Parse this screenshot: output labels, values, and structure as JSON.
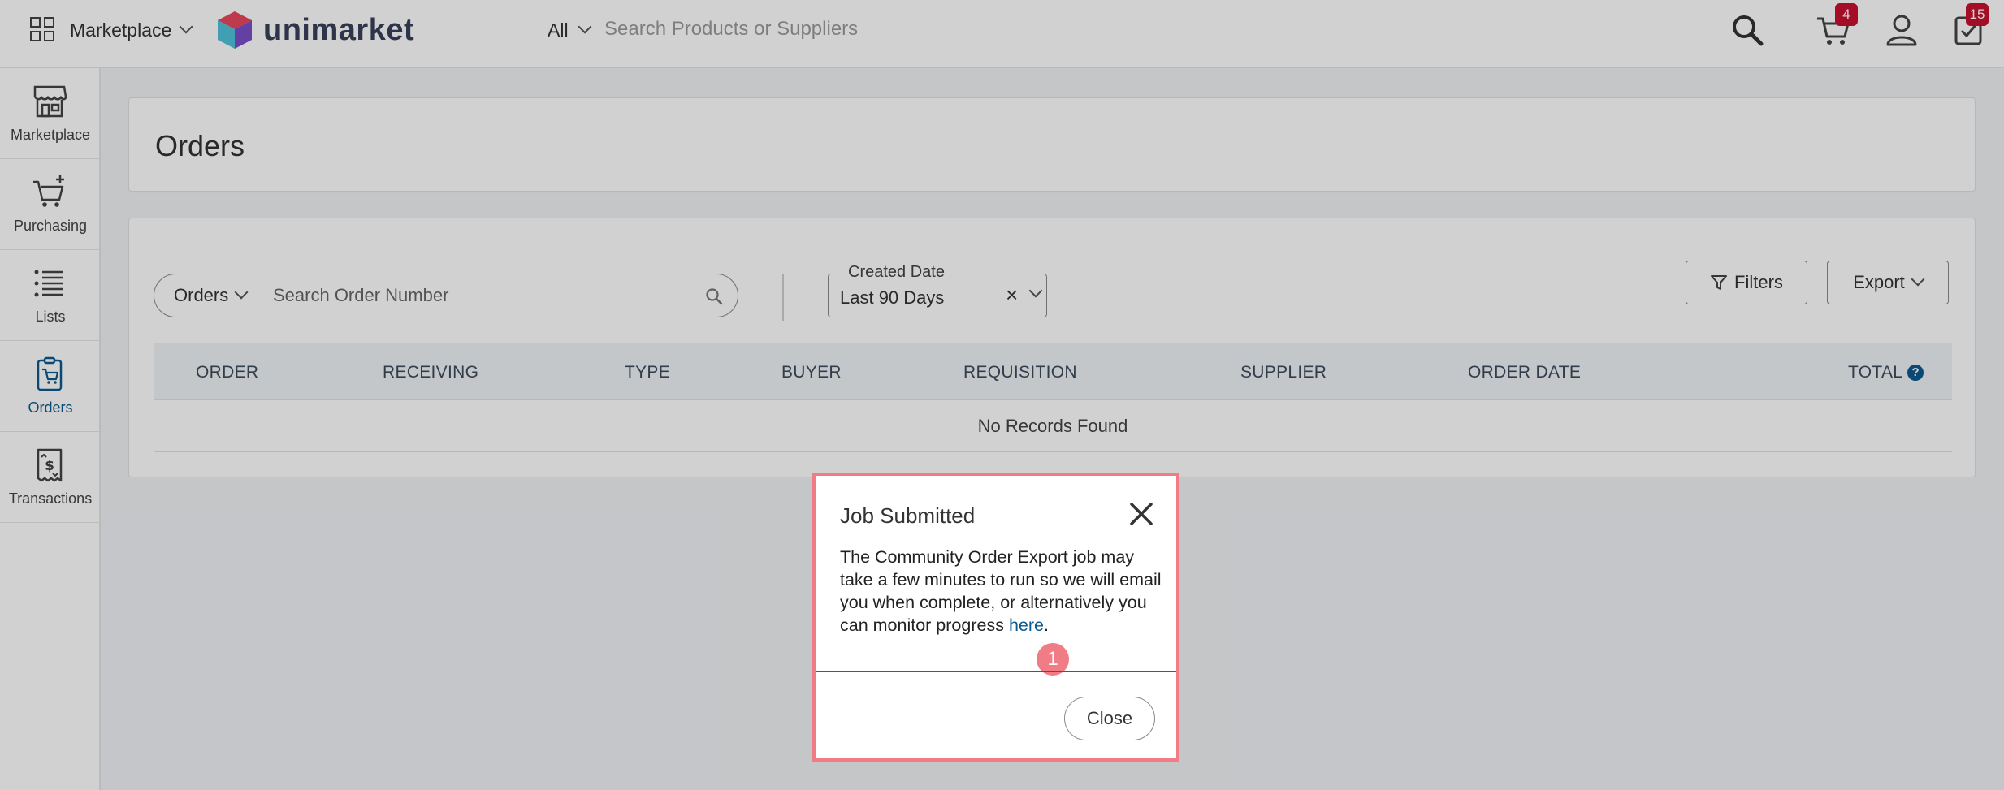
{
  "header": {
    "apps_icon": "grid-icon",
    "marketplace_switch_label": "Marketplace",
    "brand_name": "unimarket",
    "search_scope": "All",
    "search_placeholder": "Search Products or Suppliers",
    "cart_badge": "4",
    "tasks_badge": "15",
    "colors": {
      "badge": "#c8102e",
      "logo_text": "#39405a"
    }
  },
  "sidebar": {
    "items": [
      {
        "label": "Marketplace",
        "icon": "storefront-icon",
        "active": false
      },
      {
        "label": "Purchasing",
        "icon": "cart-plus-icon",
        "active": false
      },
      {
        "label": "Lists",
        "icon": "list-icon",
        "active": false
      },
      {
        "label": "Orders",
        "icon": "clipboard-cart-icon",
        "active": true
      },
      {
        "label": "Transactions",
        "icon": "receipt-icon",
        "active": false
      }
    ],
    "colors": {
      "active": "#0b5a8d"
    }
  },
  "page": {
    "title": "Orders",
    "order_search": {
      "type_label": "Orders",
      "placeholder": "Search Order Number"
    },
    "date_filter": {
      "legend": "Created Date",
      "value": "Last 90 Days",
      "clear_symbol": "×"
    },
    "filters_label": "Filters",
    "export_label": "Export",
    "table": {
      "columns": [
        "ORDER",
        "RECEIVING",
        "TYPE",
        "BUYER",
        "REQUISITION",
        "SUPPLIER",
        "ORDER DATE",
        "TOTAL"
      ],
      "empty_message": "No Records Found"
    }
  },
  "modal": {
    "title": "Job Submitted",
    "body": "The Community Order Export job may take a few minutes to run so we will email you when complete, or alternatively you can monitor progress ",
    "link_text": "here",
    "body_end": ".",
    "step_marker": "1",
    "close_label": "Close",
    "colors": {
      "highlight": "#f07c86",
      "link": "#0b5a8d"
    }
  }
}
